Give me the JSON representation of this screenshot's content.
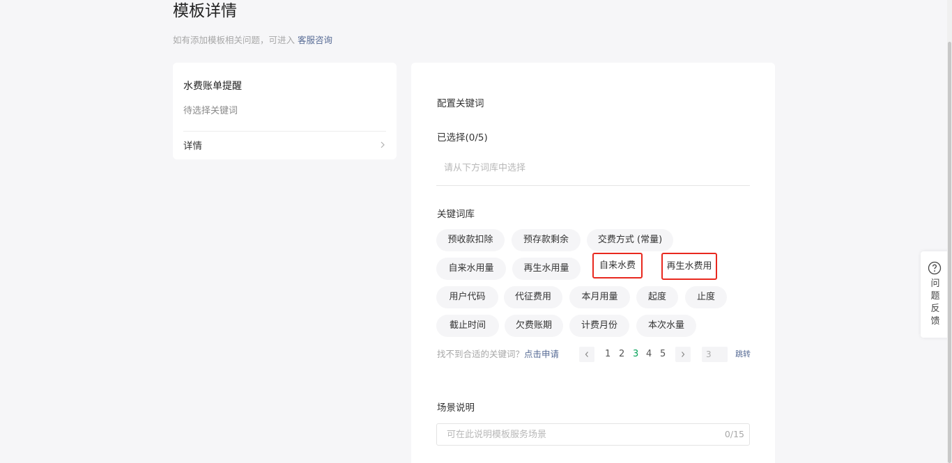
{
  "page": {
    "title": "模板详情",
    "hint": "如有添加模板相关问题，可进入",
    "hint_link": "客服咨询"
  },
  "template_card": {
    "name": "水费账单提醒",
    "subtitle": "待选择关键词",
    "detail_label": "详情"
  },
  "config": {
    "section_title": "配置关键词",
    "selected_label": "已选择(0/5)",
    "selected_placeholder": "请从下方词库中选择",
    "library_label": "关键词库",
    "keywords": [
      [
        "预收款扣除",
        "预存款剩余",
        "交费方式 (常量)"
      ],
      [
        "自来水用量",
        "再生水用量",
        "自来水费",
        "再生水费用"
      ],
      [
        "用户代码",
        "代征费用",
        "本月用量",
        "起度",
        "止度"
      ],
      [
        "截止时间",
        "欠费账期",
        "计费月份",
        "本次水量"
      ]
    ],
    "no_keyword_text": "找不到合适的关键词？",
    "apply_link": "点击申请",
    "pagination": {
      "pages": [
        "1",
        "2",
        "3",
        "4",
        "5"
      ],
      "current": "3",
      "jump_value": "3",
      "jump_label": "跳转"
    },
    "scene": {
      "label": "场景说明",
      "placeholder": "可在此说明模板服务场景",
      "counter": "0/15"
    }
  },
  "feedback": {
    "label": "问题反馈",
    "icon": "question-circle-icon"
  },
  "colors": {
    "link": "#576b95",
    "active_page": "#07a35a",
    "highlight_box": "#e8281e"
  }
}
